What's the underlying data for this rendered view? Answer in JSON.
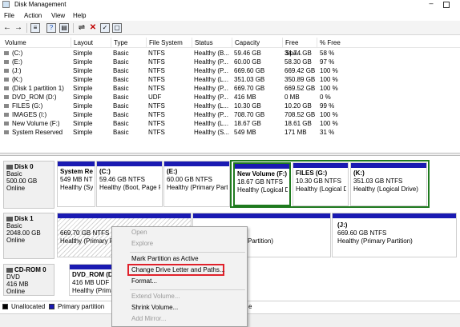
{
  "window": {
    "title": "Disk Management"
  },
  "menu": [
    "File",
    "Action",
    "View",
    "Help"
  ],
  "toolbar": {
    "icons": [
      "back-arrow-icon",
      "forward-arrow-icon",
      "volume-list-icon",
      "help-icon",
      "disk-list-icon",
      "connect-icon",
      "delete-icon",
      "properties-icon",
      "refresh-icon"
    ]
  },
  "columns": [
    "Volume",
    "Layout",
    "Type",
    "File System",
    "Status",
    "Capacity",
    "Free Spa...",
    "% Free"
  ],
  "volumes": [
    [
      "(C:)",
      "Simple",
      "Basic",
      "NTFS",
      "Healthy (B...",
      "59.46 GB",
      "34.74 GB",
      "58 %"
    ],
    [
      "(E:)",
      "Simple",
      "Basic",
      "NTFS",
      "Healthy (P...",
      "60.00 GB",
      "58.30 GB",
      "97 %"
    ],
    [
      "(J:)",
      "Simple",
      "Basic",
      "NTFS",
      "Healthy (P...",
      "669.60 GB",
      "669.42 GB",
      "100 %"
    ],
    [
      "(K:)",
      "Simple",
      "Basic",
      "NTFS",
      "Healthy (L...",
      "351.03 GB",
      "350.89 GB",
      "100 %"
    ],
    [
      "(Disk 1 partition 1)",
      "Simple",
      "Basic",
      "NTFS",
      "Healthy (P...",
      "669.70 GB",
      "669.52 GB",
      "100 %"
    ],
    [
      "DVD_ROM (D:)",
      "Simple",
      "Basic",
      "UDF",
      "Healthy (P...",
      "416 MB",
      "0 MB",
      "0 %"
    ],
    [
      "FILES (G:)",
      "Simple",
      "Basic",
      "NTFS",
      "Healthy (L...",
      "10.30 GB",
      "10.20 GB",
      "99 %"
    ],
    [
      "IMAGES (I:)",
      "Simple",
      "Basic",
      "NTFS",
      "Healthy (P...",
      "708.70 GB",
      "708.52 GB",
      "100 %"
    ],
    [
      "New Volume (F:)",
      "Simple",
      "Basic",
      "NTFS",
      "Healthy (L...",
      "18.67 GB",
      "18.61 GB",
      "100 %"
    ],
    [
      "System Reserved",
      "Simple",
      "Basic",
      "NTFS",
      "Healthy (S...",
      "549 MB",
      "171 MB",
      "31 %"
    ]
  ],
  "disks": {
    "disk0": {
      "name": "Disk 0",
      "type": "Basic",
      "size": "500.00 GB",
      "status": "Online",
      "parts": [
        {
          "title": "System Re",
          "size": "549 MB NT",
          "status": "Healthy (Sy"
        },
        {
          "title": "(C:)",
          "size": "59.46 GB NTFS",
          "status": "Healthy (Boot, Page F"
        },
        {
          "title": "(E:)",
          "size": "60.00 GB NTFS",
          "status": "Healthy (Primary Part"
        },
        {
          "title": "New Volume (F:)",
          "size": "18.67 GB NTFS",
          "status": "Healthy (Logical D"
        },
        {
          "title": "FILES (G:)",
          "size": "10.30 GB NTFS",
          "status": "Healthy (Logical D"
        },
        {
          "title": "(K:)",
          "size": "351.03 GB NTFS",
          "status": "Healthy (Logical Drive)"
        }
      ]
    },
    "disk1": {
      "name": "Disk 1",
      "type": "Basic",
      "size": "2048.00 GB",
      "status": "Online",
      "parts": [
        {
          "title": "",
          "size": "669.70 GB NTFS",
          "status": "Healthy (Primary P"
        },
        {
          "title": "",
          "size": "",
          "status": "Partition)"
        },
        {
          "title": "(J:)",
          "size": "669.60 GB NTFS",
          "status": "Healthy (Primary Partition)"
        }
      ]
    },
    "cdrom0": {
      "name": "CD-ROM 0",
      "type": "DVD",
      "size": "416 MB",
      "status": "Online",
      "parts": [
        {
          "title": "DVD_ROM  (D:)",
          "size": "416 MB UDF",
          "status": "Healthy (Primary P"
        }
      ]
    }
  },
  "legend": {
    "unallocated": "Unallocated",
    "primary": "Primary partition",
    "tail": "e"
  },
  "colors": {
    "primary": "#1a1ab2",
    "logical": "#1a1ab2",
    "selected": "#1f7a1f",
    "highlight": "#e0212b"
  },
  "context_menu": {
    "open": "Open",
    "explore": "Explore",
    "mark_active": "Mark Partition as Active",
    "change_letter": "Change Drive Letter and Paths...",
    "format": "Format...",
    "extend": "Extend Volume...",
    "shrink": "Shrink Volume...",
    "add_mirror": "Add Mirror..."
  }
}
